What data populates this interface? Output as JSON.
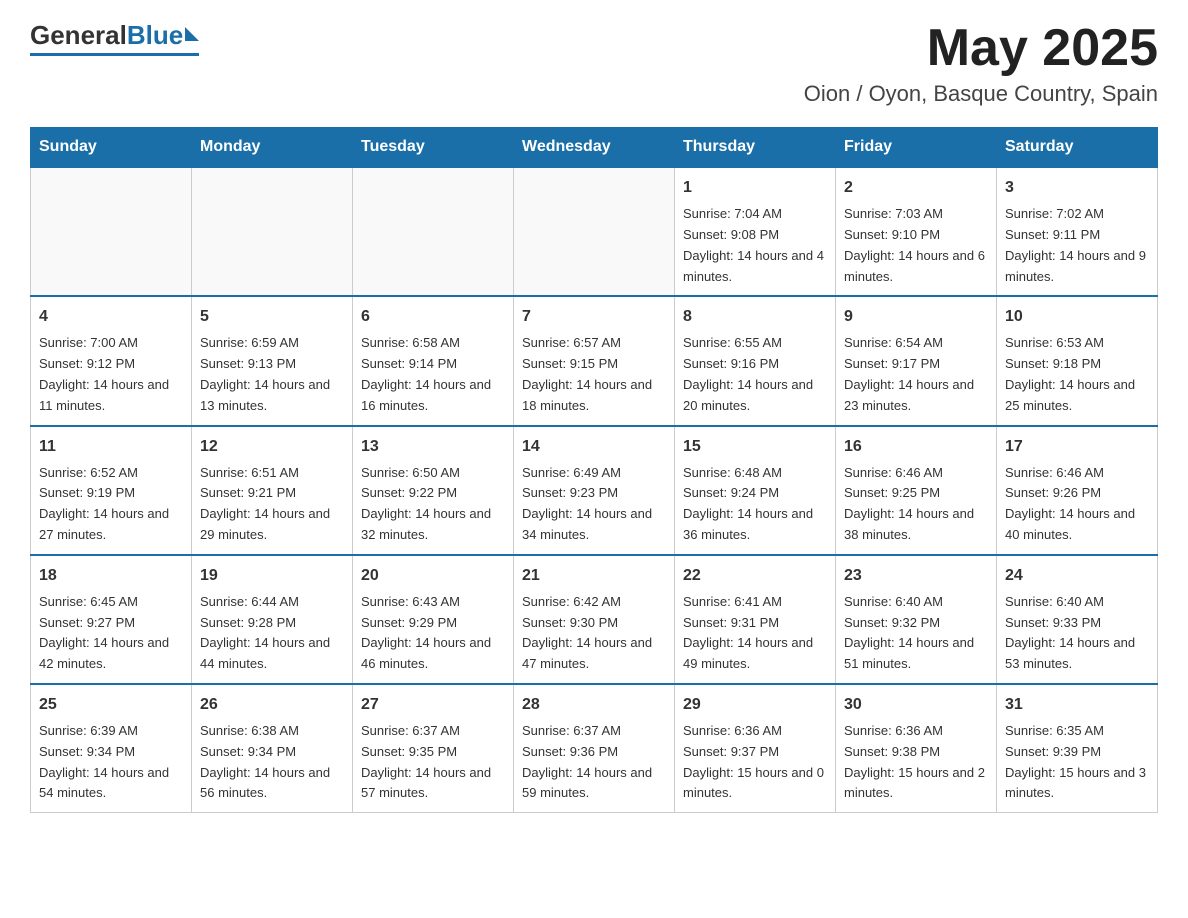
{
  "header": {
    "logo": {
      "general": "General",
      "blue": "Blue"
    },
    "title": "May 2025",
    "location": "Oion / Oyon, Basque Country, Spain"
  },
  "calendar": {
    "weekdays": [
      "Sunday",
      "Monday",
      "Tuesday",
      "Wednesday",
      "Thursday",
      "Friday",
      "Saturday"
    ],
    "weeks": [
      {
        "days": [
          {
            "number": "",
            "empty": true
          },
          {
            "number": "",
            "empty": true
          },
          {
            "number": "",
            "empty": true
          },
          {
            "number": "",
            "empty": true
          },
          {
            "number": "1",
            "sunrise": "Sunrise: 7:04 AM",
            "sunset": "Sunset: 9:08 PM",
            "daylight": "Daylight: 14 hours and 4 minutes."
          },
          {
            "number": "2",
            "sunrise": "Sunrise: 7:03 AM",
            "sunset": "Sunset: 9:10 PM",
            "daylight": "Daylight: 14 hours and 6 minutes."
          },
          {
            "number": "3",
            "sunrise": "Sunrise: 7:02 AM",
            "sunset": "Sunset: 9:11 PM",
            "daylight": "Daylight: 14 hours and 9 minutes."
          }
        ]
      },
      {
        "days": [
          {
            "number": "4",
            "sunrise": "Sunrise: 7:00 AM",
            "sunset": "Sunset: 9:12 PM",
            "daylight": "Daylight: 14 hours and 11 minutes."
          },
          {
            "number": "5",
            "sunrise": "Sunrise: 6:59 AM",
            "sunset": "Sunset: 9:13 PM",
            "daylight": "Daylight: 14 hours and 13 minutes."
          },
          {
            "number": "6",
            "sunrise": "Sunrise: 6:58 AM",
            "sunset": "Sunset: 9:14 PM",
            "daylight": "Daylight: 14 hours and 16 minutes."
          },
          {
            "number": "7",
            "sunrise": "Sunrise: 6:57 AM",
            "sunset": "Sunset: 9:15 PM",
            "daylight": "Daylight: 14 hours and 18 minutes."
          },
          {
            "number": "8",
            "sunrise": "Sunrise: 6:55 AM",
            "sunset": "Sunset: 9:16 PM",
            "daylight": "Daylight: 14 hours and 20 minutes."
          },
          {
            "number": "9",
            "sunrise": "Sunrise: 6:54 AM",
            "sunset": "Sunset: 9:17 PM",
            "daylight": "Daylight: 14 hours and 23 minutes."
          },
          {
            "number": "10",
            "sunrise": "Sunrise: 6:53 AM",
            "sunset": "Sunset: 9:18 PM",
            "daylight": "Daylight: 14 hours and 25 minutes."
          }
        ]
      },
      {
        "days": [
          {
            "number": "11",
            "sunrise": "Sunrise: 6:52 AM",
            "sunset": "Sunset: 9:19 PM",
            "daylight": "Daylight: 14 hours and 27 minutes."
          },
          {
            "number": "12",
            "sunrise": "Sunrise: 6:51 AM",
            "sunset": "Sunset: 9:21 PM",
            "daylight": "Daylight: 14 hours and 29 minutes."
          },
          {
            "number": "13",
            "sunrise": "Sunrise: 6:50 AM",
            "sunset": "Sunset: 9:22 PM",
            "daylight": "Daylight: 14 hours and 32 minutes."
          },
          {
            "number": "14",
            "sunrise": "Sunrise: 6:49 AM",
            "sunset": "Sunset: 9:23 PM",
            "daylight": "Daylight: 14 hours and 34 minutes."
          },
          {
            "number": "15",
            "sunrise": "Sunrise: 6:48 AM",
            "sunset": "Sunset: 9:24 PM",
            "daylight": "Daylight: 14 hours and 36 minutes."
          },
          {
            "number": "16",
            "sunrise": "Sunrise: 6:46 AM",
            "sunset": "Sunset: 9:25 PM",
            "daylight": "Daylight: 14 hours and 38 minutes."
          },
          {
            "number": "17",
            "sunrise": "Sunrise: 6:46 AM",
            "sunset": "Sunset: 9:26 PM",
            "daylight": "Daylight: 14 hours and 40 minutes."
          }
        ]
      },
      {
        "days": [
          {
            "number": "18",
            "sunrise": "Sunrise: 6:45 AM",
            "sunset": "Sunset: 9:27 PM",
            "daylight": "Daylight: 14 hours and 42 minutes."
          },
          {
            "number": "19",
            "sunrise": "Sunrise: 6:44 AM",
            "sunset": "Sunset: 9:28 PM",
            "daylight": "Daylight: 14 hours and 44 minutes."
          },
          {
            "number": "20",
            "sunrise": "Sunrise: 6:43 AM",
            "sunset": "Sunset: 9:29 PM",
            "daylight": "Daylight: 14 hours and 46 minutes."
          },
          {
            "number": "21",
            "sunrise": "Sunrise: 6:42 AM",
            "sunset": "Sunset: 9:30 PM",
            "daylight": "Daylight: 14 hours and 47 minutes."
          },
          {
            "number": "22",
            "sunrise": "Sunrise: 6:41 AM",
            "sunset": "Sunset: 9:31 PM",
            "daylight": "Daylight: 14 hours and 49 minutes."
          },
          {
            "number": "23",
            "sunrise": "Sunrise: 6:40 AM",
            "sunset": "Sunset: 9:32 PM",
            "daylight": "Daylight: 14 hours and 51 minutes."
          },
          {
            "number": "24",
            "sunrise": "Sunrise: 6:40 AM",
            "sunset": "Sunset: 9:33 PM",
            "daylight": "Daylight: 14 hours and 53 minutes."
          }
        ]
      },
      {
        "days": [
          {
            "number": "25",
            "sunrise": "Sunrise: 6:39 AM",
            "sunset": "Sunset: 9:34 PM",
            "daylight": "Daylight: 14 hours and 54 minutes."
          },
          {
            "number": "26",
            "sunrise": "Sunrise: 6:38 AM",
            "sunset": "Sunset: 9:34 PM",
            "daylight": "Daylight: 14 hours and 56 minutes."
          },
          {
            "number": "27",
            "sunrise": "Sunrise: 6:37 AM",
            "sunset": "Sunset: 9:35 PM",
            "daylight": "Daylight: 14 hours and 57 minutes."
          },
          {
            "number": "28",
            "sunrise": "Sunrise: 6:37 AM",
            "sunset": "Sunset: 9:36 PM",
            "daylight": "Daylight: 14 hours and 59 minutes."
          },
          {
            "number": "29",
            "sunrise": "Sunrise: 6:36 AM",
            "sunset": "Sunset: 9:37 PM",
            "daylight": "Daylight: 15 hours and 0 minutes."
          },
          {
            "number": "30",
            "sunrise": "Sunrise: 6:36 AM",
            "sunset": "Sunset: 9:38 PM",
            "daylight": "Daylight: 15 hours and 2 minutes."
          },
          {
            "number": "31",
            "sunrise": "Sunrise: 6:35 AM",
            "sunset": "Sunset: 9:39 PM",
            "daylight": "Daylight: 15 hours and 3 minutes."
          }
        ]
      }
    ]
  }
}
